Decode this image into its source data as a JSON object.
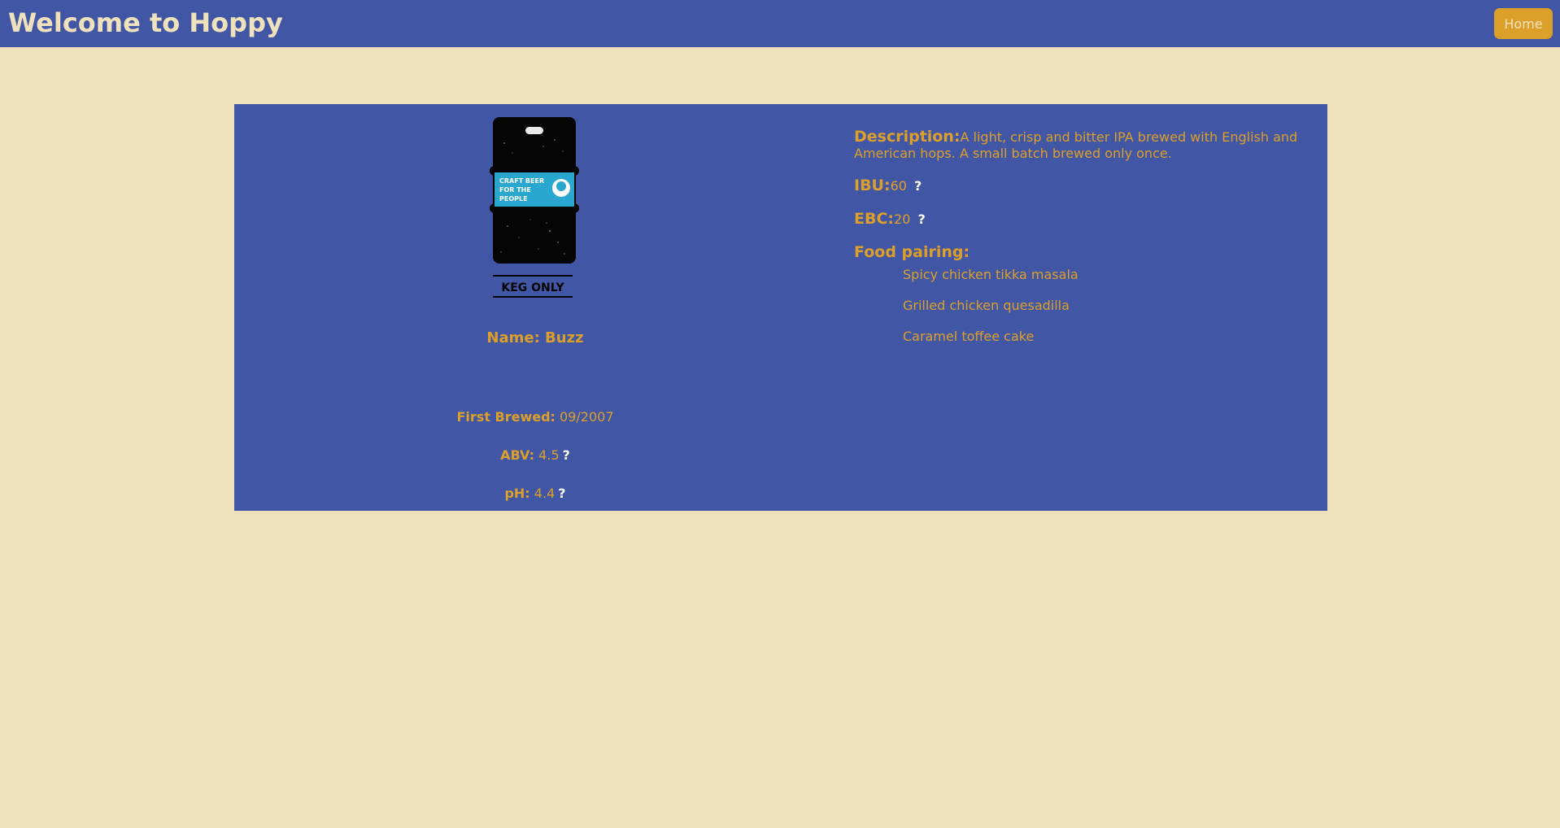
{
  "header": {
    "title": "Welcome to Hoppy",
    "home_label": "Home"
  },
  "beer": {
    "image": {
      "icon": "keg-illustration",
      "keg_label_text": "CRAFT BEER FOR THE PEOPLE",
      "caption": "KEG ONLY"
    },
    "name_label": "Name: Buzz",
    "first_brewed_label": "First Brewed:",
    "first_brewed_value": "09/2007",
    "abv_label": "ABV:",
    "abv_value": "4.5",
    "ph_label": "pH:",
    "ph_value": "4.4",
    "help_mark": "?",
    "description_label": "Description:",
    "description_value": "A light, crisp and bitter IPA brewed with English and American hops. A small batch brewed only once.",
    "ibu_label": "IBU:",
    "ibu_value": "60",
    "ebc_label": "EBC:",
    "ebc_value": "20",
    "food_pairing_label": "Food pairing:",
    "food_pairing": [
      "Spicy chicken tikka masala",
      "Grilled chicken quesadilla",
      "Caramel toffee cake"
    ]
  },
  "colors": {
    "background": "#efe1bc",
    "primary": "#4156a4",
    "accent": "#dca02a",
    "help_mark": "#ffffff"
  }
}
